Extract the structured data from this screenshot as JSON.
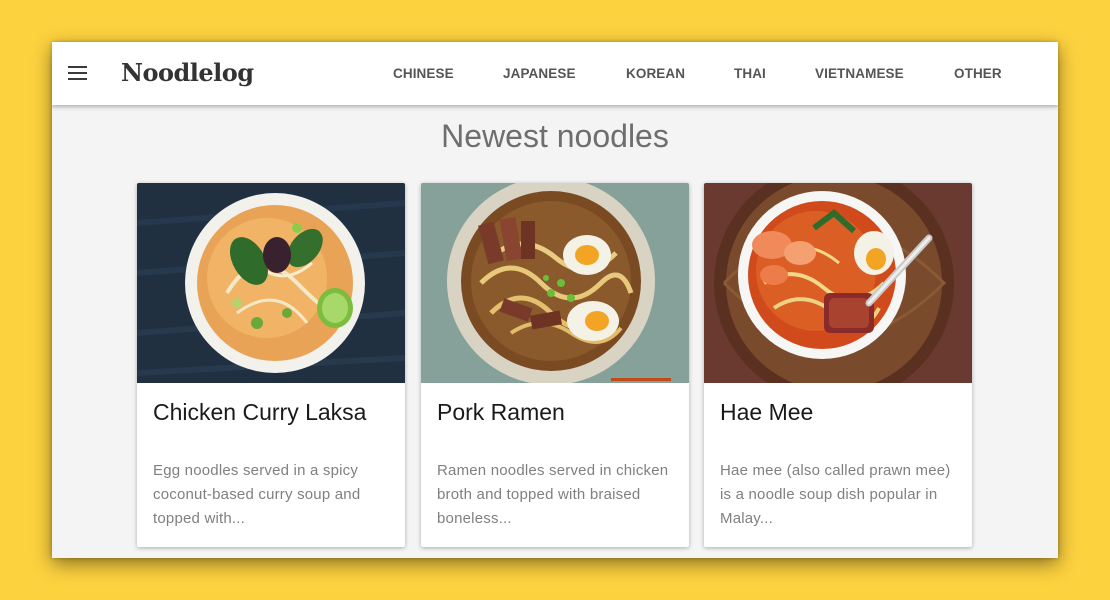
{
  "header": {
    "logo": "Noodlelog",
    "menu_icon": "hamburger-menu-icon",
    "nav": [
      {
        "label": "CHINESE"
      },
      {
        "label": "JAPANESE"
      },
      {
        "label": "KOREAN"
      },
      {
        "label": "THAI"
      },
      {
        "label": "VIETNAMESE"
      },
      {
        "label": "OTHER"
      }
    ]
  },
  "main": {
    "title": "Newest noodles",
    "cards": [
      {
        "title": "Chicken Curry Laksa",
        "description": "Egg noodles served in a spicy coconut-based curry soup and topped with...",
        "image": "laksa-bowl-photo"
      },
      {
        "title": "Pork Ramen",
        "description": "Ramen noodles served in chicken broth and topped with braised boneless...",
        "image": "ramen-bowl-photo"
      },
      {
        "title": "Hae Mee",
        "description": "Hae mee (also called prawn mee) is a noodle soup dish popular in Malay...",
        "image": "hae-mee-bowl-photo"
      }
    ]
  },
  "colors": {
    "page_background": "#fdd23f",
    "content_background": "#f4f4f4",
    "header_background": "#ffffff",
    "nav_text": "#555555",
    "title_text": "#6e6e6e",
    "card_description": "#808080"
  }
}
